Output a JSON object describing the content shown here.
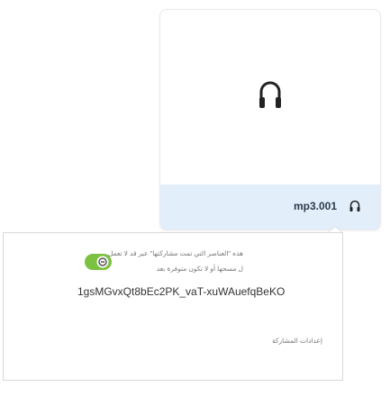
{
  "file_card": {
    "file_name": "mp3.001",
    "preview_icon": "headphones-icon",
    "footer_icon": "headphones-icon",
    "footer_bg": "#e3eefb"
  },
  "reply": {
    "notice_line1": "هذه \"العناصر التي تمت مشاركتها\" عبر قد لا تعمل",
    "notice_line2": "ل مسحها أو لا تكون متوفرة بعد",
    "link_icon": "link-icon",
    "long_id": "1gsMGvxQt8bEc2PK_vaT-xuWAuefqBeKO",
    "action_label": "إعدادات المشاركة"
  },
  "colors": {
    "link_icon_green": "#7cc142",
    "text_dark": "#333333"
  }
}
